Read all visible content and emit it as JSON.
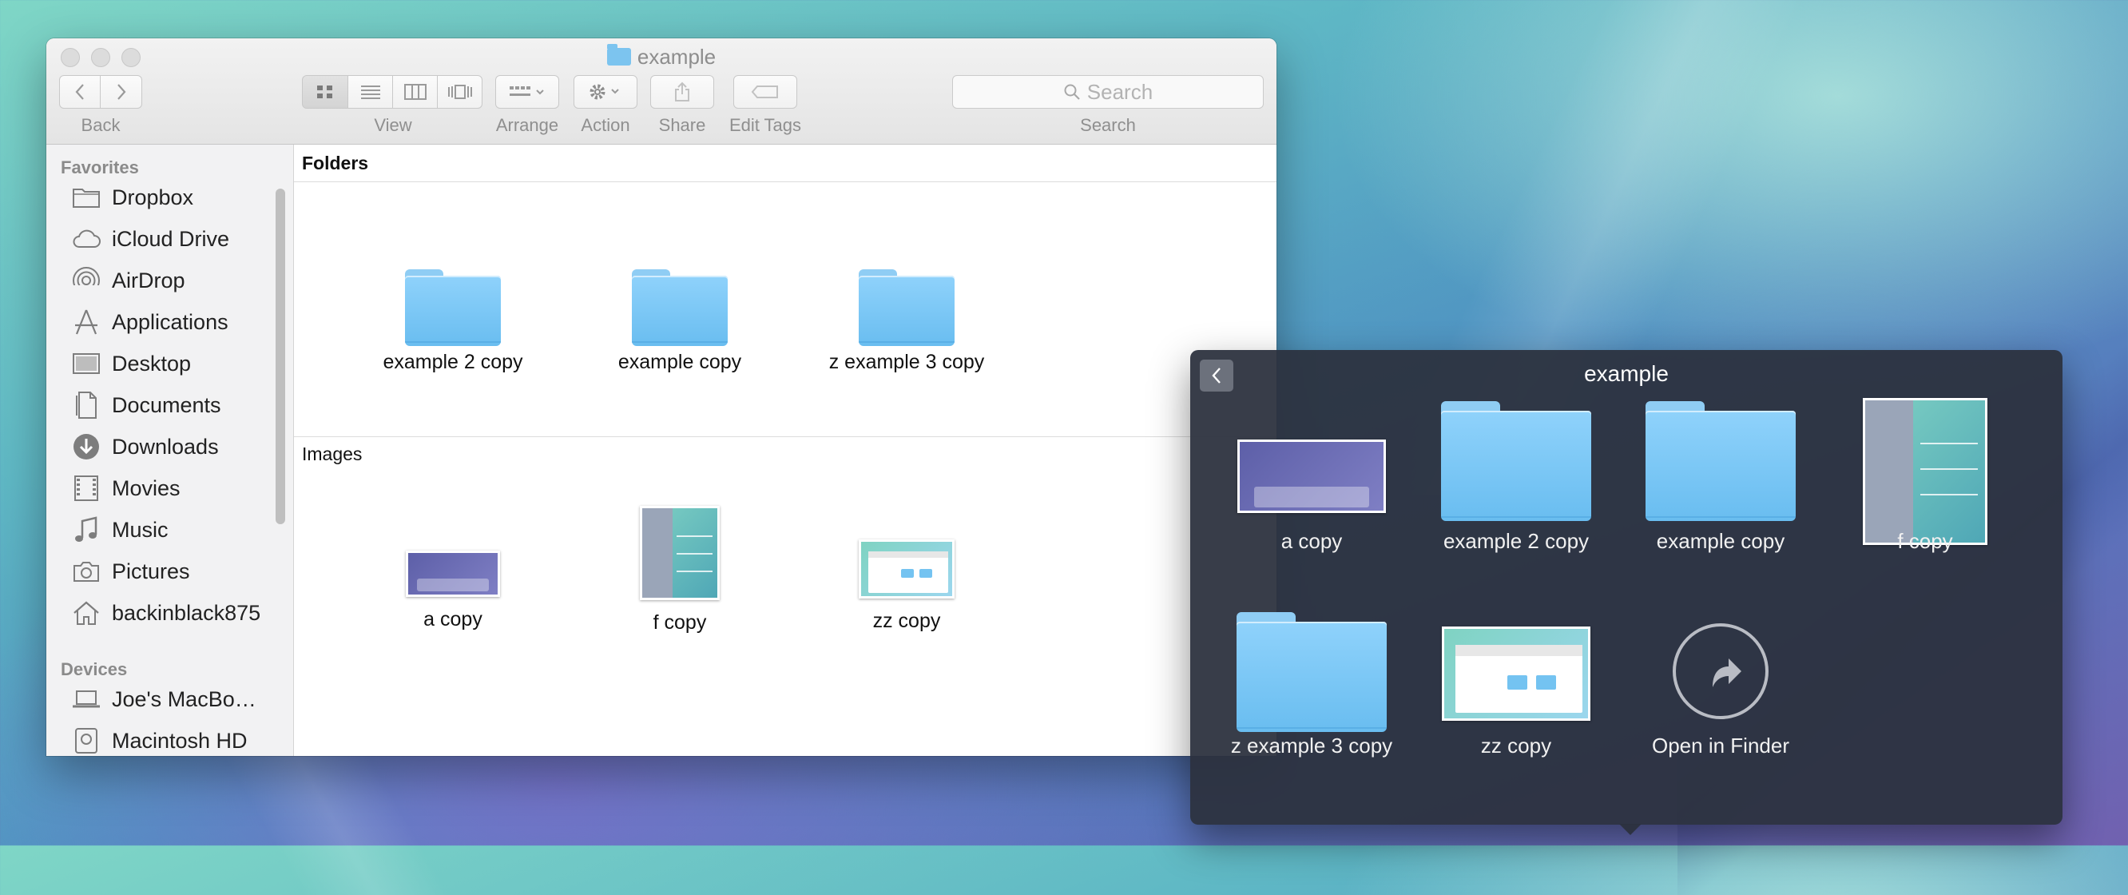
{
  "finder": {
    "title": "example",
    "toolbar": {
      "back_label": "Back",
      "view_label": "View",
      "arrange_label": "Arrange",
      "action_label": "Action",
      "share_label": "Share",
      "edit_tags_label": "Edit Tags",
      "search_label": "Search",
      "search_placeholder": "Search"
    },
    "sidebar": {
      "favorites_heading": "Favorites",
      "favorites": [
        {
          "label": "Dropbox",
          "icon": "folder-icon"
        },
        {
          "label": "iCloud Drive",
          "icon": "cloud-icon"
        },
        {
          "label": "AirDrop",
          "icon": "airdrop-icon"
        },
        {
          "label": "Applications",
          "icon": "applications-icon"
        },
        {
          "label": "Desktop",
          "icon": "desktop-icon"
        },
        {
          "label": "Documents",
          "icon": "documents-icon"
        },
        {
          "label": "Downloads",
          "icon": "downloads-icon"
        },
        {
          "label": "Movies",
          "icon": "movies-icon"
        },
        {
          "label": "Music",
          "icon": "music-icon"
        },
        {
          "label": "Pictures",
          "icon": "pictures-icon"
        },
        {
          "label": "backinblack875",
          "icon": "home-icon"
        }
      ],
      "devices_heading": "Devices",
      "devices": [
        {
          "label": "Joe's MacBo…",
          "icon": "laptop-icon"
        },
        {
          "label": "Macintosh HD",
          "icon": "disk-icon"
        }
      ]
    },
    "folders_heading": "Folders",
    "folders": [
      {
        "label": "example 2 copy"
      },
      {
        "label": "example copy"
      },
      {
        "label": "z example 3 copy"
      }
    ],
    "images_heading": "Images",
    "images": [
      {
        "label": "a copy"
      },
      {
        "label": "f copy"
      },
      {
        "label": "zz copy"
      }
    ]
  },
  "stack": {
    "title": "example",
    "items": [
      {
        "label": "a copy",
        "kind": "image-dock"
      },
      {
        "label": "example 2 copy",
        "kind": "folder"
      },
      {
        "label": "example copy",
        "kind": "folder"
      },
      {
        "label": "f copy",
        "kind": "image-teal"
      },
      {
        "label": "z example 3 copy",
        "kind": "folder"
      },
      {
        "label": "zz copy",
        "kind": "image-finder"
      },
      {
        "label": "Open in Finder",
        "kind": "open-finder"
      }
    ]
  }
}
